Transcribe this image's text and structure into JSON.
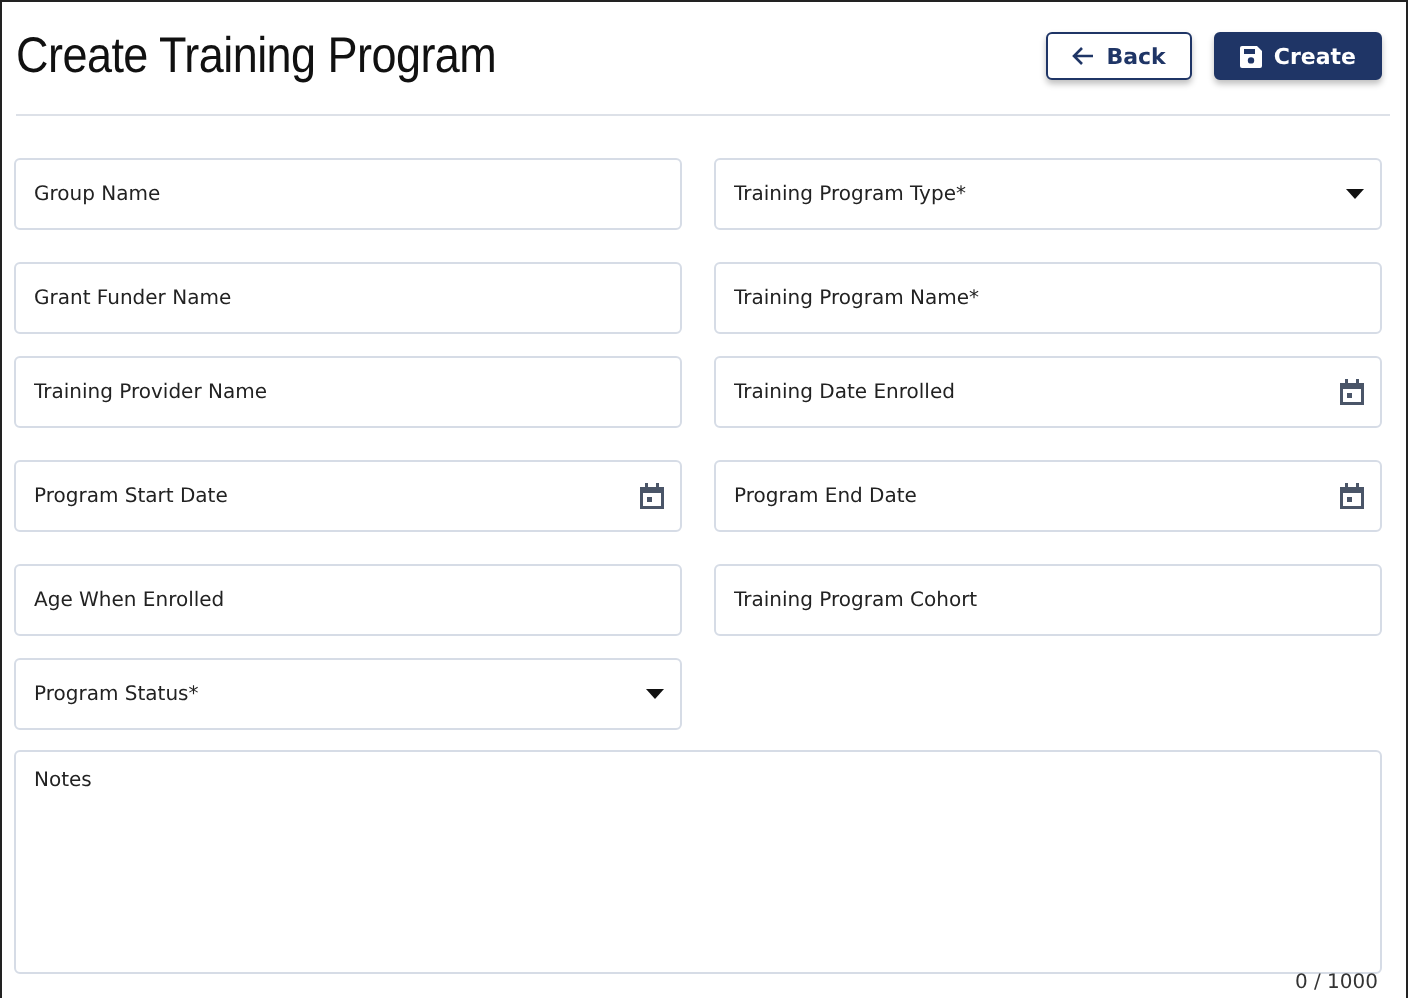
{
  "title": "Create Training Program",
  "buttons": [
    {
      "label": "Back",
      "kind": "back"
    },
    {
      "label": "Create",
      "kind": "create"
    }
  ],
  "fields": [
    {
      "placeholder": "Group Name",
      "kind": "text"
    },
    {
      "placeholder": "Training Program Type*",
      "kind": "select"
    },
    {
      "placeholder": "Grant Funder Name",
      "kind": "text"
    },
    {
      "placeholder": "Training Program Name*",
      "kind": "text"
    },
    {
      "placeholder": "Training Provider Name",
      "kind": "text"
    },
    {
      "placeholder": "Training Date Enrolled",
      "kind": "date"
    },
    {
      "placeholder": "Program Start Date",
      "kind": "date"
    },
    {
      "placeholder": "Program End Date",
      "kind": "date"
    },
    {
      "placeholder": "Age When Enrolled",
      "kind": "text"
    },
    {
      "placeholder": "Training Program Cohort",
      "kind": "text"
    },
    {
      "placeholder": "Program Status*",
      "kind": "select"
    }
  ],
  "notes": {
    "placeholder": "Notes",
    "counter": "0 / 1000"
  }
}
